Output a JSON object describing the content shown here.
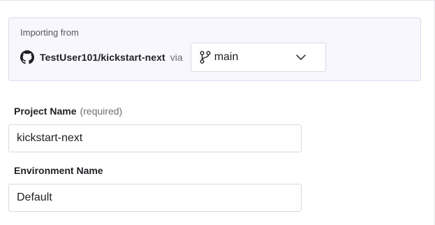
{
  "import": {
    "label": "Importing from",
    "repository": "TestUser101/kickstart-next",
    "via": "via",
    "branch": "main",
    "icons": {
      "repo": "github-icon",
      "branch": "git-branch-icon",
      "dropdown": "chevron-down-icon"
    }
  },
  "project": {
    "label": "Project Name",
    "note": "(required)",
    "value": "kickstart-next"
  },
  "environment": {
    "label": "Environment Name",
    "value": "Default"
  },
  "colors": {
    "panel_background": "#f7f7fd",
    "panel_border": "#dcdcf0",
    "input_border": "#d9dae0",
    "text": "#1f2024",
    "muted_text": "#6b6d74"
  }
}
